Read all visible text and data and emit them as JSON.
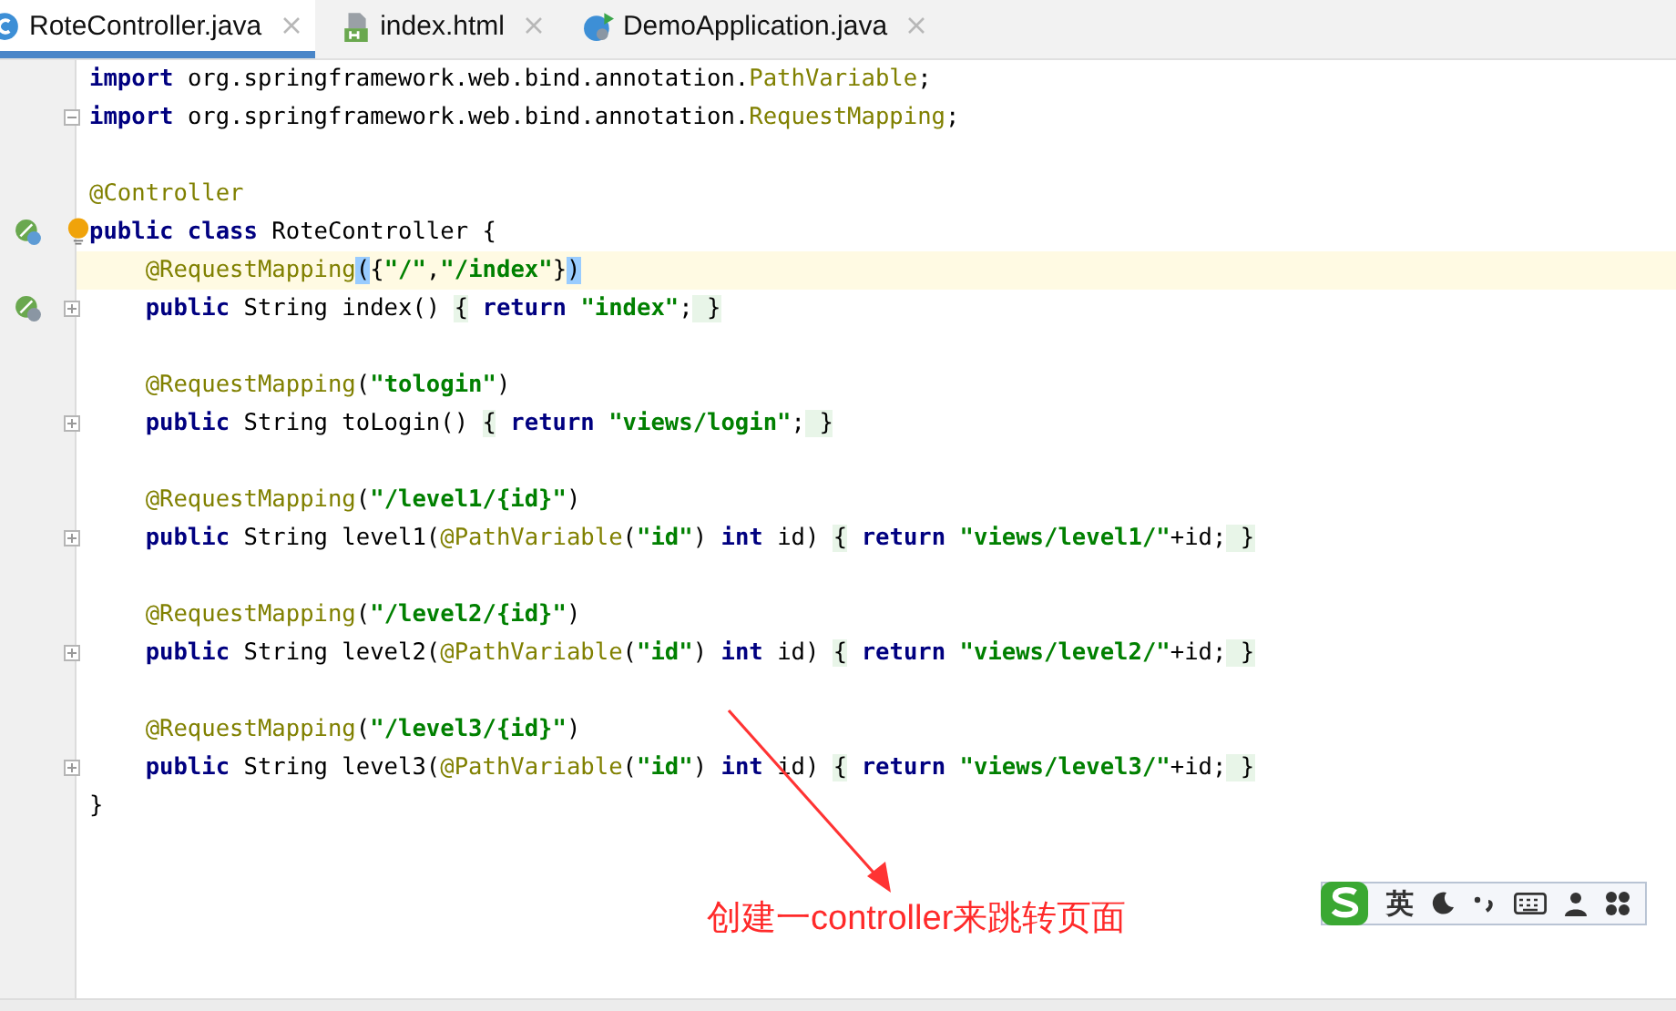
{
  "tabs": [
    {
      "label": "RoteController.java",
      "kind": "class",
      "selected": true
    },
    {
      "label": "index.html",
      "kind": "html",
      "selected": false
    },
    {
      "label": "DemoApplication.java",
      "kind": "app",
      "selected": false
    }
  ],
  "lines": [
    {
      "current": false,
      "tokens": [
        {
          "kind": "kw",
          "t": "import"
        },
        {
          "kind": "txt",
          "t": " org.springframework.web.bind.annotation."
        },
        {
          "kind": "ann",
          "t": "PathVariable"
        },
        {
          "kind": "txt",
          "t": ";"
        }
      ]
    },
    {
      "current": false,
      "markers": [
        {
          "kind": "fold-open"
        }
      ],
      "tokens": [
        {
          "kind": "kw",
          "t": "import"
        },
        {
          "kind": "txt",
          "t": " org.springframework.web.bind.annotation."
        },
        {
          "kind": "ann",
          "t": "RequestMapping"
        },
        {
          "kind": "txt",
          "t": ";"
        }
      ]
    },
    {
      "current": false
    },
    {
      "current": false,
      "tokens": [
        {
          "kind": "ann",
          "t": "@Controller"
        }
      ]
    },
    {
      "current": false,
      "markers": [
        {
          "kind": "bean"
        },
        {
          "kind": "bulb"
        }
      ],
      "tokens": [
        {
          "kind": "kw",
          "t": "public class"
        },
        {
          "kind": "txt",
          "t": " RoteController {"
        }
      ]
    },
    {
      "current": true,
      "tokens": [
        {
          "kind": "ann",
          "t": "    @RequestMapping"
        },
        {
          "kind": "match",
          "t": "("
        },
        {
          "kind": "txt",
          "t": "{"
        },
        {
          "kind": "str",
          "t": "\"/\""
        },
        {
          "kind": "txt",
          "t": ","
        },
        {
          "kind": "str",
          "t": "\"/index\""
        },
        {
          "kind": "txt",
          "t": "}"
        },
        {
          "kind": "match",
          "t": ")"
        }
      ]
    },
    {
      "current": false,
      "markers": [
        {
          "kind": "web"
        },
        {
          "kind": "fold-closed"
        }
      ],
      "tokens": [
        {
          "kind": "kw",
          "t": "    public"
        },
        {
          "kind": "txt",
          "t": " String index() "
        },
        {
          "kind": "brace",
          "t": "{"
        },
        {
          "kind": "kw",
          "t": " return"
        },
        {
          "kind": "str",
          "t": " \"index\""
        },
        {
          "kind": "txt",
          "t": ";"
        },
        {
          "kind": "brace",
          "t": " }"
        }
      ]
    },
    {
      "current": false
    },
    {
      "current": false,
      "tokens": [
        {
          "kind": "ann",
          "t": "    @RequestMapping"
        },
        {
          "kind": "txt",
          "t": "("
        },
        {
          "kind": "str",
          "t": "\"tologin\""
        },
        {
          "kind": "txt",
          "t": ")"
        }
      ]
    },
    {
      "current": false,
      "markers": [
        {
          "kind": "fold-closed"
        }
      ],
      "tokens": [
        {
          "kind": "kw",
          "t": "    public"
        },
        {
          "kind": "txt",
          "t": " String toLogin() "
        },
        {
          "kind": "brace",
          "t": "{"
        },
        {
          "kind": "kw",
          "t": " return"
        },
        {
          "kind": "str",
          "t": " \"views/login\""
        },
        {
          "kind": "txt",
          "t": ";"
        },
        {
          "kind": "brace",
          "t": " }"
        }
      ]
    },
    {
      "current": false
    },
    {
      "current": false,
      "tokens": [
        {
          "kind": "ann",
          "t": "    @RequestMapping"
        },
        {
          "kind": "txt",
          "t": "("
        },
        {
          "kind": "str",
          "t": "\"/level1/{id}\""
        },
        {
          "kind": "txt",
          "t": ")"
        }
      ]
    },
    {
      "current": false,
      "markers": [
        {
          "kind": "fold-closed"
        }
      ],
      "tokens": [
        {
          "kind": "kw",
          "t": "    public"
        },
        {
          "kind": "txt",
          "t": " String level1("
        },
        {
          "kind": "ann",
          "t": "@PathVariable"
        },
        {
          "kind": "txt",
          "t": "("
        },
        {
          "kind": "str",
          "t": "\"id\""
        },
        {
          "kind": "txt",
          "t": ") "
        },
        {
          "kind": "kw",
          "t": "int"
        },
        {
          "kind": "txt",
          "t": " id) "
        },
        {
          "kind": "brace",
          "t": "{"
        },
        {
          "kind": "kw",
          "t": " return"
        },
        {
          "kind": "str",
          "t": " \"views/level1/\""
        },
        {
          "kind": "txt",
          "t": "+id;"
        },
        {
          "kind": "brace",
          "t": " }"
        }
      ]
    },
    {
      "current": false
    },
    {
      "current": false,
      "tokens": [
        {
          "kind": "ann",
          "t": "    @RequestMapping"
        },
        {
          "kind": "txt",
          "t": "("
        },
        {
          "kind": "str",
          "t": "\"/level2/{id}\""
        },
        {
          "kind": "txt",
          "t": ")"
        }
      ]
    },
    {
      "current": false,
      "markers": [
        {
          "kind": "fold-closed"
        }
      ],
      "tokens": [
        {
          "kind": "kw",
          "t": "    public"
        },
        {
          "kind": "txt",
          "t": " String level2("
        },
        {
          "kind": "ann",
          "t": "@PathVariable"
        },
        {
          "kind": "txt",
          "t": "("
        },
        {
          "kind": "str",
          "t": "\"id\""
        },
        {
          "kind": "txt",
          "t": ") "
        },
        {
          "kind": "kw",
          "t": "int"
        },
        {
          "kind": "txt",
          "t": " id) "
        },
        {
          "kind": "brace",
          "t": "{"
        },
        {
          "kind": "kw",
          "t": " return"
        },
        {
          "kind": "str",
          "t": " \"views/level2/\""
        },
        {
          "kind": "txt",
          "t": "+id;"
        },
        {
          "kind": "brace",
          "t": " }"
        }
      ]
    },
    {
      "current": false
    },
    {
      "current": false,
      "tokens": [
        {
          "kind": "ann",
          "t": "    @RequestMapping"
        },
        {
          "kind": "txt",
          "t": "("
        },
        {
          "kind": "str",
          "t": "\"/level3/{id}\""
        },
        {
          "kind": "txt",
          "t": ")"
        }
      ]
    },
    {
      "current": false,
      "markers": [
        {
          "kind": "fold-closed"
        }
      ],
      "tokens": [
        {
          "kind": "kw",
          "t": "    public"
        },
        {
          "kind": "txt",
          "t": " String level3("
        },
        {
          "kind": "ann",
          "t": "@PathVariable"
        },
        {
          "kind": "txt",
          "t": "("
        },
        {
          "kind": "str",
          "t": "\"id\""
        },
        {
          "kind": "txt",
          "t": ") "
        },
        {
          "kind": "kw",
          "t": "int"
        },
        {
          "kind": "txt",
          "t": " id) "
        },
        {
          "kind": "brace",
          "t": "{"
        },
        {
          "kind": "kw",
          "t": " return"
        },
        {
          "kind": "str",
          "t": " \"views/level3/\""
        },
        {
          "kind": "txt",
          "t": "+id;"
        },
        {
          "kind": "brace",
          "t": " }"
        }
      ]
    },
    {
      "current": false,
      "tokens": [
        {
          "kind": "txt",
          "t": "}"
        }
      ]
    }
  ],
  "callout": {
    "text": "创建一controller来跳转页面"
  },
  "ime_toolbar": {
    "mode": "英"
  }
}
